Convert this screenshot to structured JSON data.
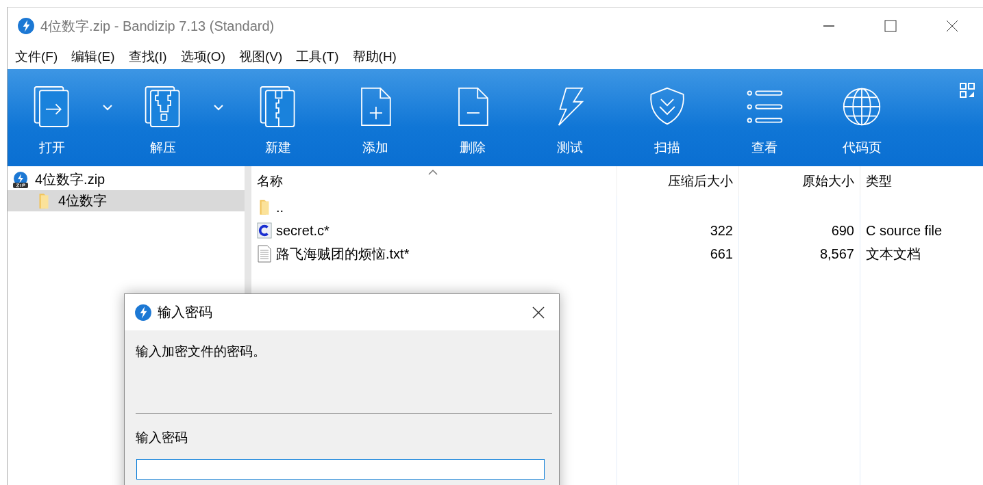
{
  "window": {
    "title": "4位数字.zip - Bandizip 7.13 (Standard)"
  },
  "menu": [
    "文件(F)",
    "编辑(E)",
    "查找(I)",
    "选项(O)",
    "视图(V)",
    "工具(T)",
    "帮助(H)"
  ],
  "toolbar": [
    {
      "label": "打开",
      "kind": "open",
      "dropdown": true
    },
    {
      "label": "解压",
      "kind": "extract",
      "dropdown": true
    },
    {
      "label": "新建",
      "kind": "new",
      "dropdown": false
    },
    {
      "label": "添加",
      "kind": "add",
      "dropdown": false
    },
    {
      "label": "删除",
      "kind": "delete",
      "dropdown": false
    },
    {
      "label": "测试",
      "kind": "test",
      "dropdown": false
    },
    {
      "label": "扫描",
      "kind": "scan",
      "dropdown": false
    },
    {
      "label": "查看",
      "kind": "view",
      "dropdown": false
    },
    {
      "label": "代码页",
      "kind": "codepage",
      "dropdown": false
    }
  ],
  "tree": [
    {
      "label": "4位数字.zip",
      "kind": "archive",
      "selected": false,
      "children": [
        {
          "label": "4位数字",
          "kind": "folder",
          "selected": true
        }
      ]
    }
  ],
  "file_list": {
    "columns": [
      {
        "label": "名称",
        "sorted": true
      },
      {
        "label": "压缩后大小",
        "sorted": false
      },
      {
        "label": "原始大小",
        "sorted": false
      },
      {
        "label": "类型",
        "sorted": false
      }
    ],
    "rows": [
      {
        "kind": "folder",
        "name": ".."
      },
      {
        "kind": "c-source",
        "name": "secret.c*",
        "compressed": "322",
        "original": "690",
        "type": "C source file"
      },
      {
        "kind": "text",
        "name": "路飞海贼团的烦恼.txt*",
        "compressed": "661",
        "original": "8,567",
        "type": "文本文档"
      }
    ]
  },
  "dialog": {
    "title": "输入密码",
    "message": "输入加密文件的密码。",
    "field_label": "输入密码"
  }
}
